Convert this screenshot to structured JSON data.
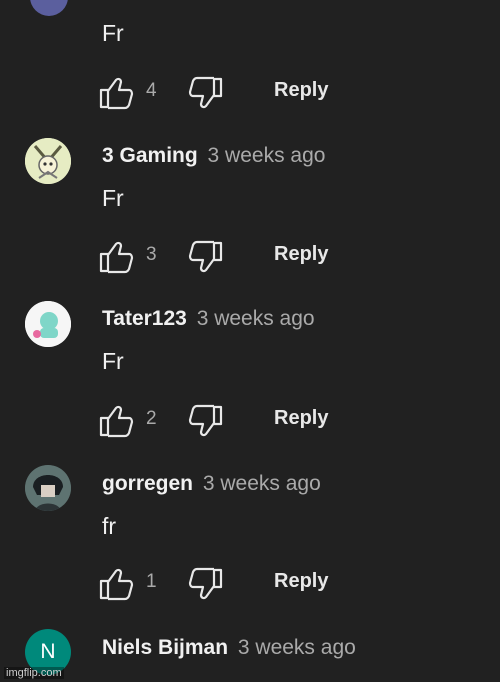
{
  "comments": [
    {
      "text": "Fr",
      "likes": "4",
      "reply": "Reply"
    },
    {
      "author": "3 Gaming",
      "time": "3 weeks ago",
      "text": "Fr",
      "likes": "3",
      "reply": "Reply"
    },
    {
      "author": "Tater123",
      "time": "3 weeks ago",
      "text": "Fr",
      "likes": "2",
      "reply": "Reply"
    },
    {
      "author": "gorregen",
      "time": "3 weeks ago",
      "text": "fr",
      "likes": "1",
      "reply": "Reply"
    },
    {
      "author": "Niels Bijman",
      "time": "3 weeks ago",
      "avatar_letter": "N",
      "avatar_color": "#00897b"
    }
  ],
  "watermark": "imgflip.com"
}
